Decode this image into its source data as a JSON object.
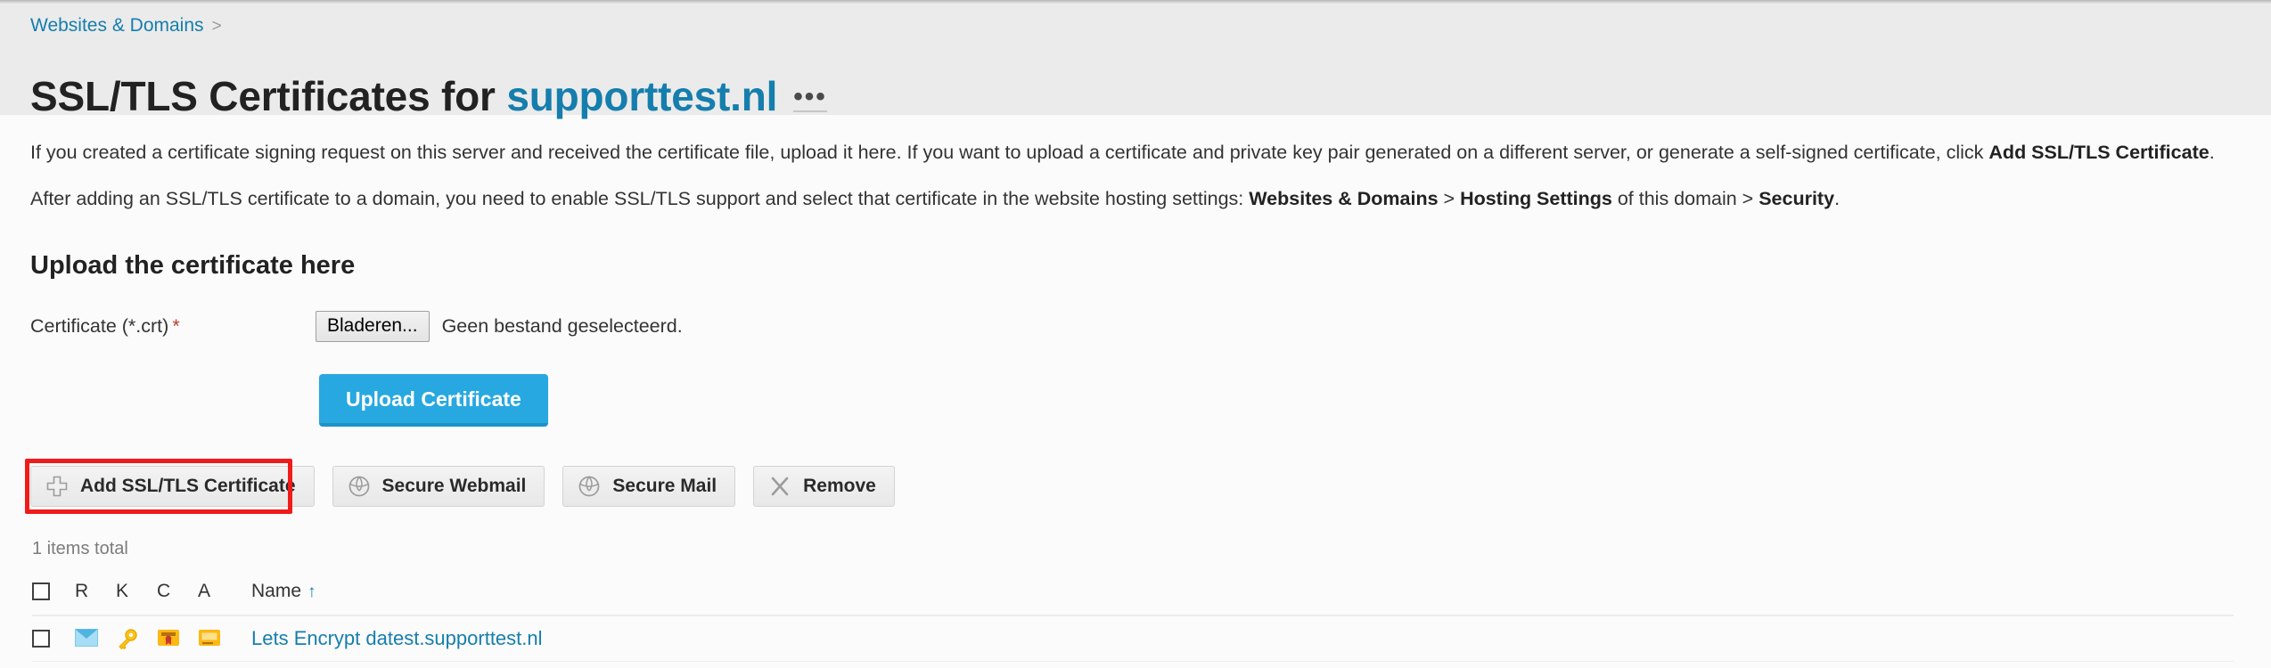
{
  "breadcrumb": {
    "items": [
      {
        "label": "Websites & Domains"
      }
    ],
    "separator": ">"
  },
  "header": {
    "title_prefix": "SSL/TLS Certificates for ",
    "domain": "supporttest.nl",
    "menu_label": "•••",
    "menu_icon": "ellipsis-icon"
  },
  "intro": {
    "paragraph1_part1": "If you created a certificate signing request on this server and received the certificate file, upload it here. If you want to upload a certificate and private key pair generated on a different server, or generate a self-signed certificate, click ",
    "paragraph1_bold": "Add SSL/TLS Certificate",
    "paragraph1_part2": ".",
    "paragraph2_part1": "After adding an SSL/TLS certificate to a domain, you need to enable SSL/TLS support and select that certificate in the website hosting settings: ",
    "paragraph2_bold1": "Websites & Domains",
    "paragraph2_sep1": " > ",
    "paragraph2_bold2": "Hosting Settings",
    "paragraph2_mid": " of this domain > ",
    "paragraph2_bold3": "Security",
    "paragraph2_end": "."
  },
  "upload_section": {
    "title": "Upload the certificate here",
    "field_label": "Certificate (*.crt)",
    "required_marker": "*",
    "browse_button": "Bladeren...",
    "file_status": "Geen bestand geselecteerd.",
    "submit_button": "Upload Certificate",
    "submit_color": "#28a8e0"
  },
  "toolbar": {
    "buttons": [
      {
        "label": "Add SSL/TLS Certificate",
        "icon": "plus-icon",
        "highlighted": true
      },
      {
        "label": "Secure Webmail",
        "icon": "globe-shield-icon",
        "highlighted": false
      },
      {
        "label": "Secure Mail",
        "icon": "globe-shield-icon",
        "highlighted": false
      },
      {
        "label": "Remove",
        "icon": "cross-icon",
        "highlighted": false
      }
    ],
    "highlight_color": "#f01b1b"
  },
  "list": {
    "items_total": "1 items total",
    "columns": [
      {
        "key": "checkbox",
        "label": ""
      },
      {
        "key": "r",
        "label": "R"
      },
      {
        "key": "k",
        "label": "K"
      },
      {
        "key": "c",
        "label": "C"
      },
      {
        "key": "a",
        "label": "A"
      },
      {
        "key": "name",
        "label": "Name",
        "sorted": true,
        "sort_direction": "↑"
      }
    ],
    "rows": [
      {
        "checked": false,
        "r_icon": "mail-envelope-icon",
        "k_icon": "key-icon",
        "c_icon": "certificate-seal-icon",
        "a_icon": "ca-certificate-icon",
        "name": "Lets Encrypt datest.supporttest.nl"
      }
    ]
  }
}
